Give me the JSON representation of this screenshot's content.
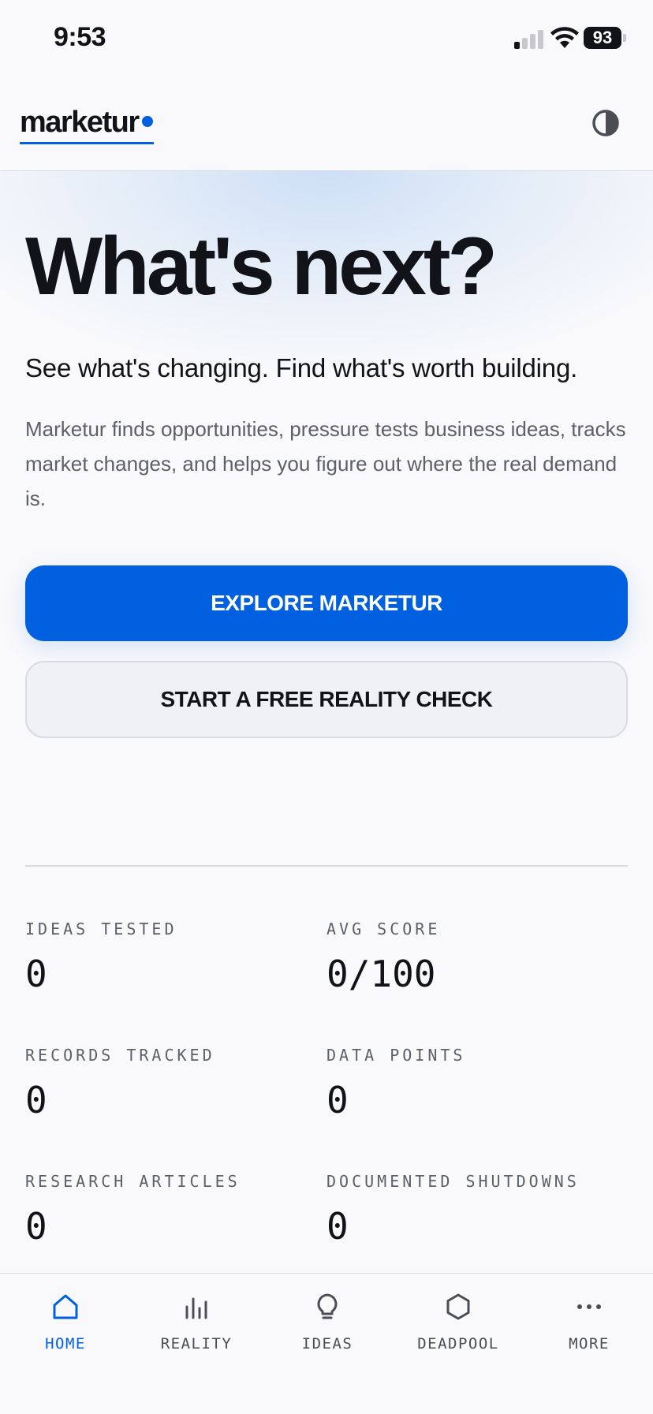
{
  "status_bar": {
    "time": "9:53",
    "battery": "93"
  },
  "header": {
    "logo": "marketur",
    "theme_toggle_icon": "contrast-icon"
  },
  "hero": {
    "title": "What's next?",
    "subtitle": "See what's changing. Find what's worth building.",
    "description": "Marketur finds opportunities, pressure tests business ideas, tracks market changes, and helps you figure out where the real demand is.",
    "primary_button": "EXPLORE MARKETUR",
    "secondary_button": "START A FREE REALITY CHECK"
  },
  "stats": [
    {
      "label": "IDEAS TESTED",
      "value": "0"
    },
    {
      "label": "AVG SCORE",
      "value": "0/100"
    },
    {
      "label": "RECORDS TRACKED",
      "value": "0"
    },
    {
      "label": "DATA POINTS",
      "value": "0"
    },
    {
      "label": "RESEARCH ARTICLES",
      "value": "0"
    },
    {
      "label": "DOCUMENTED SHUTDOWNS",
      "value": "0"
    }
  ],
  "tabs": [
    {
      "label": "HOME",
      "icon": "home-icon",
      "active": true
    },
    {
      "label": "REALITY",
      "icon": "bar-chart-icon"
    },
    {
      "label": "IDEAS",
      "icon": "lightbulb-icon"
    },
    {
      "label": "DEADPOOL",
      "icon": "hexagon-icon"
    },
    {
      "label": "MORE",
      "icon": "more-dots-icon"
    }
  ],
  "colors": {
    "accent": "#0060df",
    "text": "#111318",
    "muted": "#5d6068",
    "background": "#f9f9fb"
  }
}
